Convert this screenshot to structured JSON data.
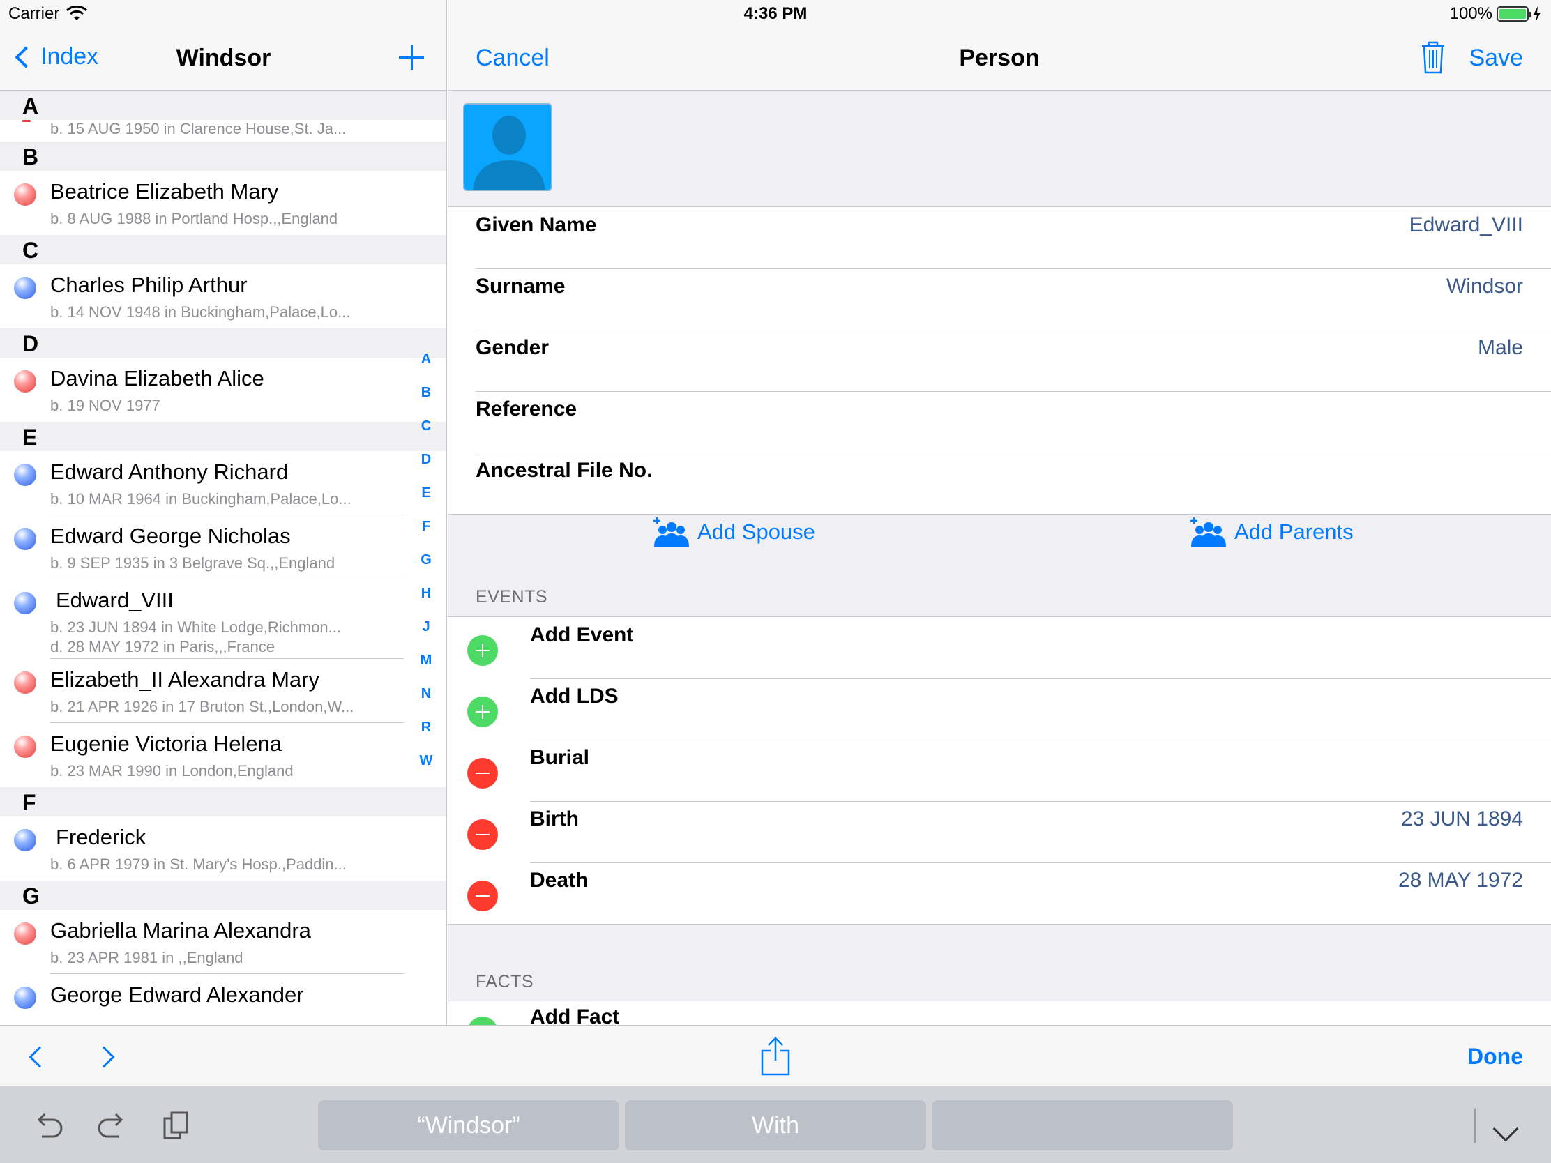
{
  "status_bar": {
    "carrier": "Carrier",
    "time": "4:36 PM",
    "battery": "100%"
  },
  "master": {
    "back_label": "Index",
    "title": "Windsor",
    "index_letters": [
      "A",
      "B",
      "C",
      "D",
      "E",
      "F",
      "G",
      "H",
      "J",
      "M",
      "N",
      "R",
      "W"
    ],
    "sections": {
      "A": {
        "header": "A",
        "partial_detail": "b.  15 AUG 1950 in Clarence House,St. Ja..."
      },
      "B": {
        "header": "B",
        "rows": [
          {
            "name": "Beatrice Elizabeth Mary",
            "line1": "b.  8 AUG 1988 in Portland Hosp.,,England"
          }
        ]
      },
      "C": {
        "header": "C",
        "rows": [
          {
            "name": "Charles Philip Arthur",
            "line1": "b.  14 NOV 1948 in Buckingham,Palace,Lo..."
          }
        ]
      },
      "D": {
        "header": "D",
        "rows": [
          {
            "name": "Davina Elizabeth Alice",
            "line1": "b.  19 NOV 1977"
          }
        ]
      },
      "E": {
        "header": "E",
        "rows": [
          {
            "name": "Edward Anthony Richard",
            "line1": "b.  10 MAR 1964 in Buckingham,Palace,Lo..."
          },
          {
            "name": "Edward George Nicholas",
            "line1": "b.  9 SEP 1935 in 3 Belgrave Sq.,,England"
          },
          {
            "name": "Edward_VIII",
            "line1": "b.  23 JUN 1894 in White Lodge,Richmon...",
            "line2": "d.  28 MAY 1972 in Paris,,,France"
          },
          {
            "name": "Elizabeth_II Alexandra Mary",
            "line1": "b.  21 APR 1926 in 17 Bruton St.,London,W..."
          },
          {
            "name": "Eugenie Victoria Helena",
            "line1": "b.  23 MAR 1990 in London,England"
          }
        ]
      },
      "F": {
        "header": "F",
        "rows": [
          {
            "name": "Frederick",
            "line1": "b.  6 APR 1979 in St. Mary's Hosp.,Paddin..."
          }
        ]
      },
      "G": {
        "header": "G",
        "rows": [
          {
            "name": "Gabriella Marina Alexandra",
            "line1": "b.  23 APR 1981 in ,,England"
          },
          {
            "name": "George Edward Alexander"
          }
        ]
      }
    }
  },
  "detail": {
    "cancel_label": "Cancel",
    "title": "Person",
    "save_label": "Save",
    "fields": {
      "given_name": {
        "label": "Given Name",
        "value": "Edward_VIII"
      },
      "surname": {
        "label": "Surname",
        "value": "Windsor"
      },
      "gender": {
        "label": "Gender",
        "value": "Male"
      },
      "reference": {
        "label": "Reference",
        "value": ""
      },
      "afn": {
        "label": "Ancestral File No.",
        "value": ""
      }
    },
    "add_spouse": "Add Spouse",
    "add_parents": "Add Parents",
    "events_header": "EVENTS",
    "events": {
      "add_event": {
        "label": "Add Event"
      },
      "add_lds": {
        "label": "Add LDS"
      },
      "burial": {
        "label": "Burial",
        "value": ""
      },
      "birth": {
        "label": "Birth",
        "value": "23 JUN 1894"
      },
      "death": {
        "label": "Death",
        "value": "28 MAY 1972"
      }
    },
    "facts_header": "FACTS",
    "add_fact": "Add Fact"
  },
  "toolbar": {
    "done_label": "Done"
  },
  "keyboard_bar": {
    "suggestions": [
      "“Windsor”",
      "With",
      ""
    ]
  },
  "colors": {
    "accent": "#007aff",
    "value_text": "#3b5a8a",
    "add_green": "#4cd964",
    "delete_red": "#ff3b30",
    "photo_blue": "#0aa5ff"
  }
}
